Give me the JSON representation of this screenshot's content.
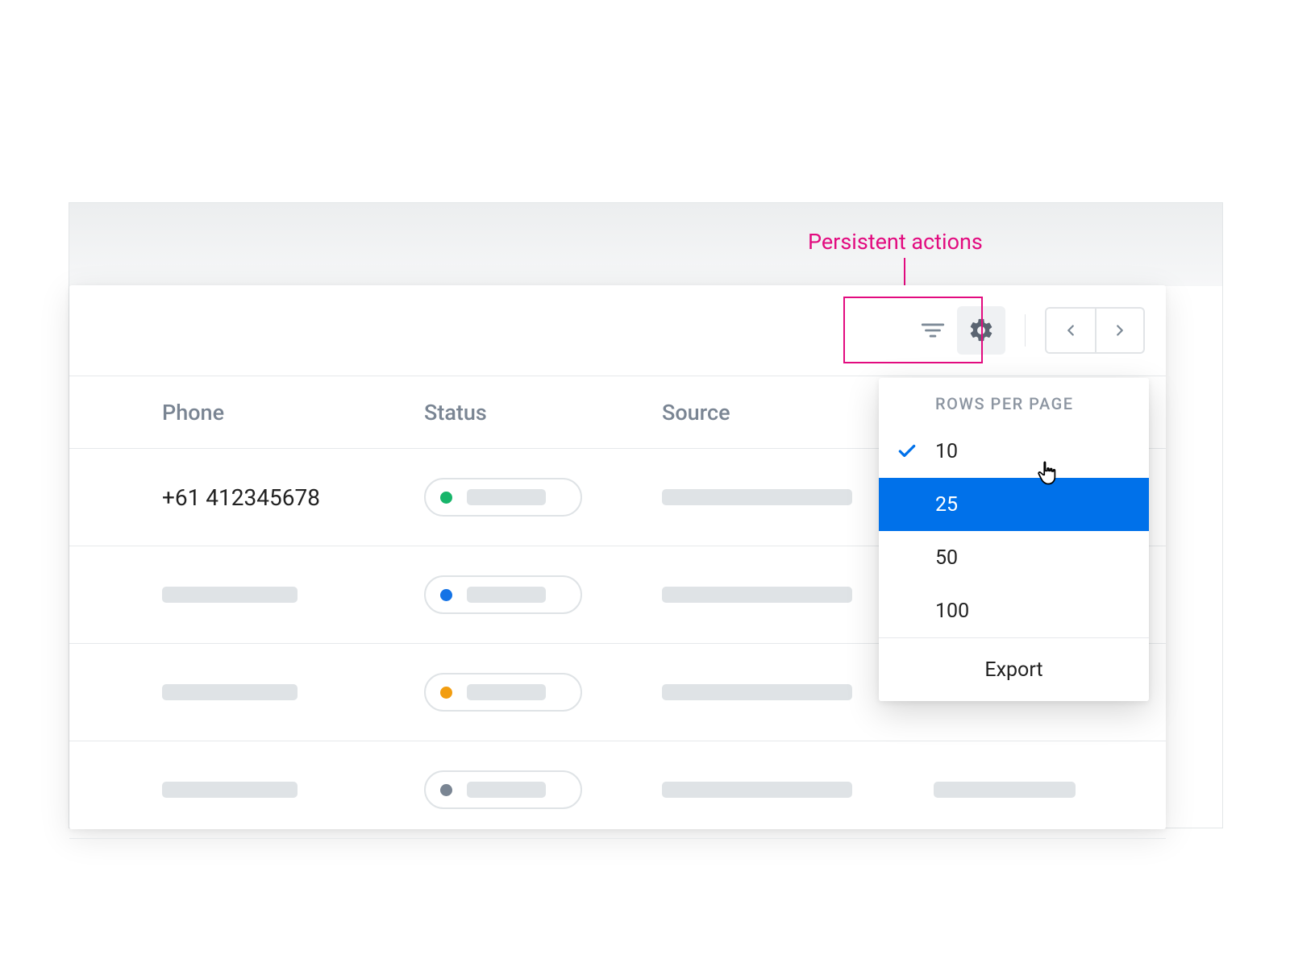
{
  "annotation": {
    "label": "Persistent actions"
  },
  "columns": {
    "phone": "Phone",
    "status": "Status",
    "source": "Source"
  },
  "rows": [
    {
      "phone": "+61 412345678",
      "status_color": "green"
    },
    {
      "phone": "",
      "status_color": "blue"
    },
    {
      "phone": "",
      "status_color": "orange"
    },
    {
      "phone": "",
      "status_color": "grey"
    }
  ],
  "menu": {
    "heading": "ROWS PER PAGE",
    "options": [
      "10",
      "25",
      "50",
      "100"
    ],
    "checked": "10",
    "hovered": "25",
    "export": "Export"
  },
  "colors": {
    "annotation": "#e20b7f",
    "highlight": "#0071ea"
  }
}
